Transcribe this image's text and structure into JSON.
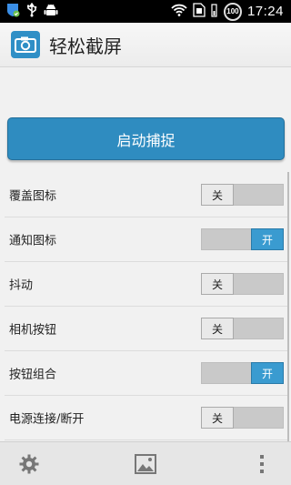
{
  "status_bar": {
    "time": "17:24",
    "battery_badge": "100"
  },
  "action_bar": {
    "title": "轻松截屏",
    "icon": "camera-icon"
  },
  "main": {
    "capture_button": "启动捕捉",
    "settings": [
      {
        "label": "覆盖图标",
        "state": "关",
        "on": false
      },
      {
        "label": "通知图标",
        "state": "开",
        "on": true
      },
      {
        "label": "抖动",
        "state": "关",
        "on": false
      },
      {
        "label": "相机按钮",
        "state": "关",
        "on": false
      },
      {
        "label": "按钮组合",
        "state": "开",
        "on": true
      },
      {
        "label": "电源连接/断开",
        "state": "关",
        "on": false
      }
    ]
  },
  "bottom_bar": {
    "icons": [
      "gear-icon",
      "gallery-icon",
      "overflow-menu-icon"
    ]
  },
  "colors": {
    "accent": "#2f8cc0",
    "toggle_on": "#3a9bd0"
  }
}
